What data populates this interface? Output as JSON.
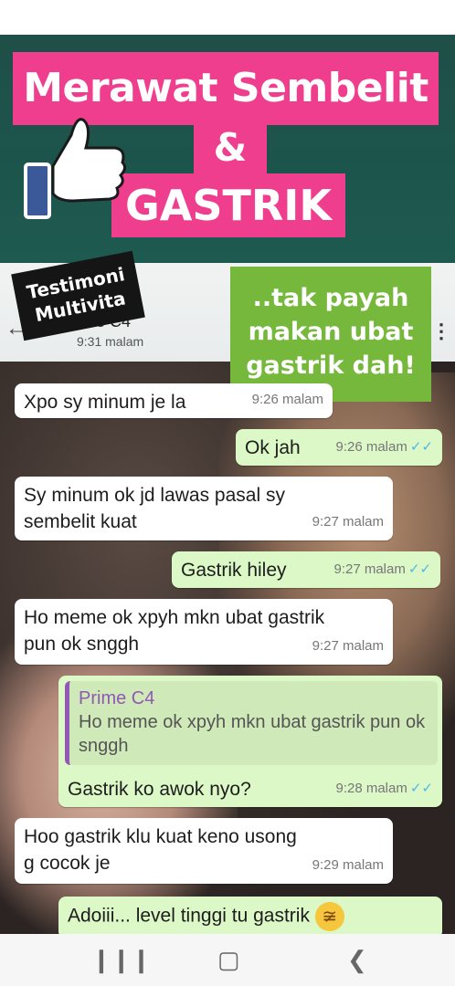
{
  "banner": {
    "line1": "Merawat Sembelit",
    "line2": "&",
    "line3": "GASTRIK",
    "thumb_icon": "thumbs-up-icon"
  },
  "badges": {
    "testimoni": [
      "Testimoni",
      "Multivita"
    ],
    "green": [
      "..tak payah",
      "makan ubat",
      "gastrik dah!"
    ]
  },
  "chat_header": {
    "back_icon": "back-arrow-icon",
    "contact_name": "ime C4",
    "status_time": "9:31 malam",
    "menu_icon": "more-vert-icon"
  },
  "messages": [
    {
      "dir": "in",
      "text": "Xpo sy minum je la",
      "time": "9:26 malam"
    },
    {
      "dir": "out",
      "text": "Ok jah",
      "time": "9:26 malam"
    },
    {
      "dir": "in",
      "text": "Sy minum ok jd lawas pasal sy sembelit kuat",
      "time": "9:27 malam"
    },
    {
      "dir": "out",
      "text": "Gastrik hiley",
      "time": "9:27 malam"
    },
    {
      "dir": "in",
      "text": "Ho meme ok xpyh mkn ubat gastrik pun ok snggh",
      "time": "9:27 malam"
    },
    {
      "dir": "out",
      "quote_name": "Prime C4",
      "quote_text": "Ho meme ok xpyh mkn ubat gastrik pun ok snggh",
      "text": "Gastrik ko awok nyo?",
      "time": "9:28 malam"
    },
    {
      "dir": "in",
      "text": "Hoo gastrik klu kuat keno usong g cocok je",
      "time": "9:29 malam"
    },
    {
      "dir": "out",
      "text": "Adoiii... level tinggi tu gastrik",
      "emoji": "rolling-laughing-emoji"
    }
  ],
  "nav": {
    "recents_icon": "recents-icon",
    "home_icon": "home-icon",
    "back_icon": "nav-back-icon"
  },
  "colors": {
    "banner_pink": "#ef3e8d",
    "badge_green": "#76b83c",
    "outgoing_bubble": "#dbf8c6",
    "incoming_bubble": "#ffffff",
    "quote_accent": "#9158b4",
    "read_tick": "#4fb6ec"
  }
}
